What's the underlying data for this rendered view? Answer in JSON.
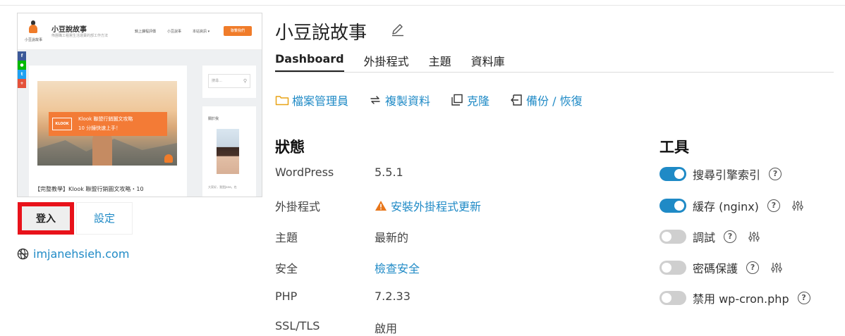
{
  "site": {
    "name": "小豆說故事",
    "domain": "imjanehsieh.com"
  },
  "preview": {
    "header_title": "小豆說故事",
    "header_subtitle": "佈團職工租憲生活運賣的部工作方法",
    "logo_caption": "小豆說故事",
    "nav": [
      "鍋上課程評價",
      "小豆說事",
      "本站資訊 ▾"
    ],
    "nav_button": "聯繫我們",
    "social": [
      {
        "icon": "facebook-icon",
        "glyph": "f",
        "color": "#3b5998"
      },
      {
        "icon": "line-icon",
        "glyph": "●",
        "color": "#00b900"
      },
      {
        "icon": "twitter-icon",
        "glyph": "t",
        "color": "#1da1f2"
      },
      {
        "icon": "plus-icon",
        "glyph": "+",
        "color": "#e4513a"
      }
    ],
    "banner_logo": "KLOOK",
    "banner_line1": "Klook 聯盟行銷圖文攻略",
    "banner_line2": "10 分鐘快速上手！",
    "post_caption": "【完整教學】Klook 聯盟行銷圖文攻略・10",
    "search_placeholder": "搜尋…",
    "sidebar_title": "關於我",
    "sidebar_caption": "大家好，我是Jane。也"
  },
  "buttons": {
    "login": "登入",
    "settings": "設定"
  },
  "tabs": [
    "Dashboard",
    "外掛程式",
    "主題",
    "資料庫"
  ],
  "actions": [
    {
      "label": "檔案管理員",
      "icon": "folder-icon"
    },
    {
      "label": "複製資料",
      "icon": "sync-icon"
    },
    {
      "label": "克隆",
      "icon": "clone-icon"
    },
    {
      "label": "備份 / 恢復",
      "icon": "backup-icon"
    }
  ],
  "status": {
    "title": "狀態",
    "rows": [
      {
        "label": "WordPress",
        "value": "5.5.1",
        "link": false
      },
      {
        "label": "外掛程式",
        "value": "安裝外掛程式更新",
        "link": true,
        "warning": true
      },
      {
        "label": "主題",
        "value": "最新的",
        "link": false
      },
      {
        "label": "安全",
        "value": "檢查安全",
        "link": true
      },
      {
        "label": "PHP",
        "value": "7.2.33",
        "link": false
      },
      {
        "label": "SSL/TLS",
        "value": "啟用",
        "link": false
      }
    ]
  },
  "tools": {
    "title": "工具",
    "items": [
      {
        "label": "搜尋引擎索引",
        "on": true,
        "adjust": false
      },
      {
        "label": "緩存 (nginx)",
        "on": true,
        "adjust": true
      },
      {
        "label": "調試",
        "on": false,
        "adjust": true
      },
      {
        "label": "密碼保護",
        "on": false,
        "adjust": true
      },
      {
        "label": "禁用 wp-cron.php",
        "on": false,
        "adjust": false
      }
    ]
  },
  "colors": {
    "accent": "#1f8ac6",
    "toggle_off": "#cfcfcf",
    "highlight": "#e8121a",
    "warning": "#e8761a"
  }
}
